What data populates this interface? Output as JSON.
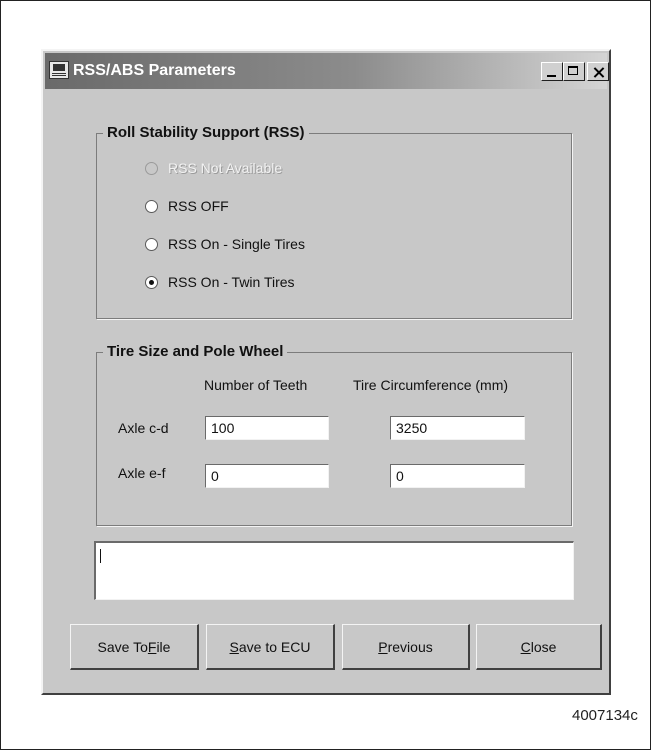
{
  "window": {
    "title": "RSS/ABS Parameters",
    "controls": [
      "minimize-icon",
      "maximize-icon",
      "close-icon"
    ]
  },
  "rss_group": {
    "title": "Roll Stability Support (RSS)",
    "options": [
      {
        "label": "RSS Not Available",
        "enabled": false,
        "selected": false
      },
      {
        "label": "RSS OFF",
        "enabled": true,
        "selected": false
      },
      {
        "label": "RSS On - Single Tires",
        "enabled": true,
        "selected": false
      },
      {
        "label": "RSS On - Twin Tires",
        "enabled": true,
        "selected": true
      }
    ]
  },
  "tire_group": {
    "title": "Tire Size and Pole Wheel",
    "col_teeth": "Number of Teeth",
    "col_circumference": "Tire Circumference (mm)",
    "rows": [
      {
        "label": "Axle c-d",
        "teeth": "100",
        "circumference": "3250"
      },
      {
        "label": "Axle e-f",
        "teeth": "0",
        "circumference": "0"
      }
    ]
  },
  "message_box": {
    "value": ""
  },
  "buttons": {
    "save_file": {
      "before": "Save To ",
      "mnemonic": "F",
      "after": "ile"
    },
    "save_ecu": {
      "before": "",
      "mnemonic": "S",
      "after": "ave to ECU"
    },
    "previous": {
      "before": "",
      "mnemonic": "P",
      "after": "revious"
    },
    "close": {
      "before": "",
      "mnemonic": "C",
      "after": "lose"
    }
  },
  "figure_number": "4007134c"
}
